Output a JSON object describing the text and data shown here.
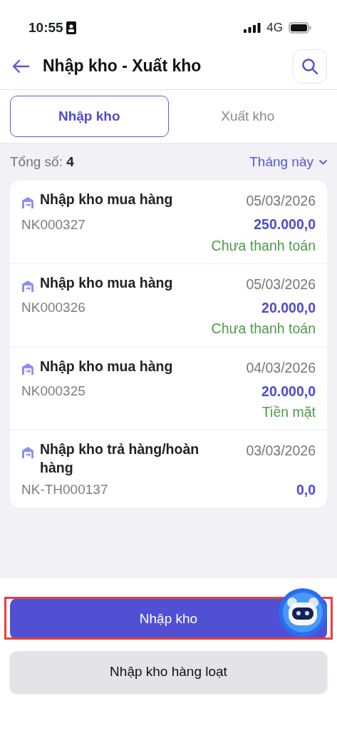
{
  "status_bar": {
    "time": "10:55",
    "network": "4G"
  },
  "header": {
    "title": "Nhập kho - Xuất kho"
  },
  "tabs": [
    {
      "label": "Nhập kho",
      "selected": true
    },
    {
      "label": "Xuất kho",
      "selected": false
    }
  ],
  "summary": {
    "label": "Tổng số:",
    "count": "4",
    "filter": "Tháng này"
  },
  "entries": [
    {
      "title": "Nhập kho mua hàng",
      "code": "NK000327",
      "date": "05/03/2026",
      "amount": "250.000,0",
      "payment": "Chưa thanh toán"
    },
    {
      "title": "Nhập kho mua hàng",
      "code": "NK000326",
      "date": "05/03/2026",
      "amount": "20.000,0",
      "payment": "Chưa thanh toán"
    },
    {
      "title": "Nhập kho mua hàng",
      "code": "NK000325",
      "date": "04/03/2026",
      "amount": "20.000,0",
      "payment": "Tiền mặt"
    },
    {
      "title": "Nhập kho trả hàng/hoàn hàng",
      "code": "NK-TH000137",
      "date": "03/03/2026",
      "amount": "0,0"
    }
  ],
  "buttons": [
    {
      "label": "Nhập kho",
      "kind": "primary",
      "highlighted": true
    },
    {
      "label": "Nhập kho hàng loạt",
      "kind": "secondary",
      "highlighted": false
    }
  ]
}
